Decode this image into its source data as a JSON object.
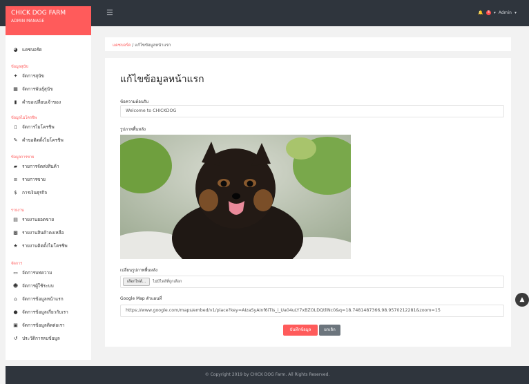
{
  "brand": {
    "title": "CHICK DOG FARM",
    "subtitle": "ADMIN MANAGE"
  },
  "topbar": {
    "notifications": "3",
    "user": "Admin"
  },
  "sidebar": {
    "dashboard": "แดชบอร์ด",
    "sections": [
      {
        "title": "ข้อมูลสุนัข",
        "items": [
          "จัดการสุนัข",
          "จัดการพันธุ์สุนัข",
          "คำขอเปลี่ยนเจ้าของ"
        ]
      },
      {
        "title": "ข้อมูลไมโครชิพ",
        "items": [
          "จัดการไมโครชิพ",
          "คำขอติดตั้งไมโครชิพ"
        ]
      },
      {
        "title": "ข้อมูลการขาย",
        "items": [
          "รายการจัดส่งสินค้า",
          "รายการขาย",
          "การเงินธุรกิจ"
        ]
      },
      {
        "title": "รายงาน",
        "items": [
          "รายงานยอดขาย",
          "รายงานสินค้าคงเหลือ",
          "รายงานติดตั้งไมโครชิพ"
        ]
      },
      {
        "title": "จัดการ",
        "items": [
          "จัดการบทความ",
          "จัดการผู้ใช้ระบบ",
          "จัดการข้อมูลหน้าแรก",
          "จัดการข้อมูลเกี่ยวกับเรา",
          "จัดการข้อมูลติดต่อเรา",
          "ประวัติการลบข้อมูล"
        ]
      }
    ]
  },
  "breadcrumb": {
    "home": "แดชบอร์ด",
    "separator": "/",
    "current": "แก้ไขข้อมูลหน้าแรก"
  },
  "form": {
    "title": "แก้ไขข้อมูลหน้าแรก",
    "welcome_label": "ข้อความต้อนรับ",
    "welcome_value": "Welcome to CHICKDOG",
    "bg_label": "รูปภาพพื้นหลัง",
    "change_bg_label": "เปลี่ยนรูปภาพพื้นหลัง",
    "choose_file": "เลือกไฟล์...",
    "no_file": "ไม่มีไฟล์ที่ถูกเลือก",
    "map_label": "Google Map ตัวแผนที่",
    "map_value": "https://www.google.com/maps/embed/v1/place?key=AIzaSyAInf6iTIs_i_Ua04uLY7xBZOLDQtllNc0&q=18.7481487366,98.9570212281&zoom=15",
    "save_label": "บันทึกข้อมูล",
    "cancel_label": "ยกเลิก"
  },
  "footer": {
    "text": "© Copyright 2019 by CHICK DOG Farm. All Rights Reserved."
  }
}
